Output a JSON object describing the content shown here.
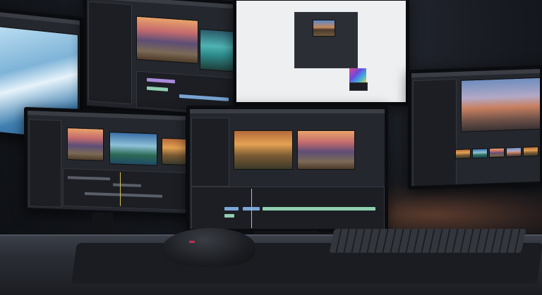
{
  "scene": {
    "description_hidden": "",
    "monitors": [
      "monitor-far-left",
      "monitor-top-left",
      "monitor-top-center",
      "monitor-right",
      "monitor-mid-left",
      "monitor-center"
    ],
    "peripherals": [
      "keyboard",
      "mouse",
      "mousepad"
    ],
    "colors": {
      "background": "#15181e",
      "desk": "#2a2d34",
      "ui_panel": "#24272d",
      "clip_blue": "#7aa6d8",
      "clip_green": "#8fcfb0",
      "clip_purple": "#a98ad8",
      "playhead": "#d9c24a"
    }
  }
}
